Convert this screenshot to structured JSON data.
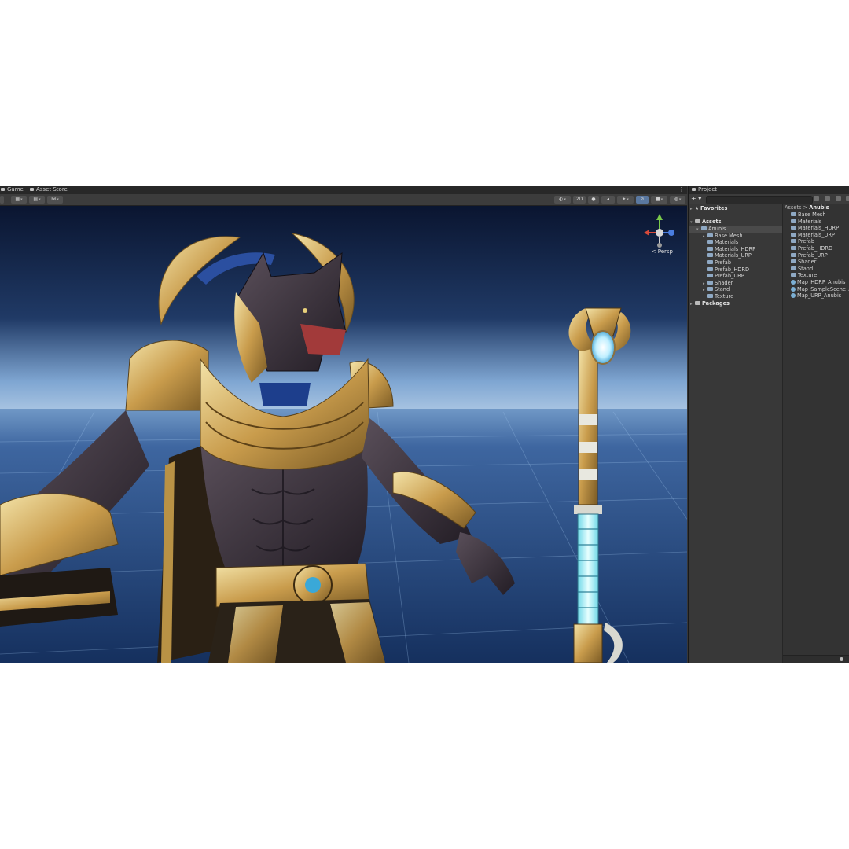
{
  "scene_tabs": [
    {
      "label": "Game"
    },
    {
      "label": "Asset Store"
    }
  ],
  "scene_toolbar": {
    "mode_2d": "2D",
    "persp_label": "< Persp",
    "more": "⋮"
  },
  "project": {
    "tab_label": "Project",
    "add_label": "+ ▾",
    "search_placeholder": "",
    "tree": {
      "favorites": "Favorites",
      "assets": "Assets",
      "anubis": "Anubis",
      "children": [
        "Base Mesh",
        "Materials",
        "Materials_HDRP",
        "Materials_URP",
        "Prefab",
        "Prefab_HDRD",
        "Prefab_URP",
        "Shader",
        "Stand",
        "Texture"
      ],
      "packages": "Packages"
    },
    "breadcrumb": {
      "root": "Assets",
      "sep": ">",
      "current": "Anubis"
    },
    "grid_items": [
      {
        "label": "Base Mesh",
        "icon": "folder-icon"
      },
      {
        "label": "Materials",
        "icon": "folder-icon"
      },
      {
        "label": "Materials_HDRP",
        "icon": "folder-icon"
      },
      {
        "label": "Materials_URP",
        "icon": "folder-icon"
      },
      {
        "label": "Prefab",
        "icon": "folder-icon"
      },
      {
        "label": "Prefab_HDRD",
        "icon": "folder-icon"
      },
      {
        "label": "Prefab_URP",
        "icon": "folder-icon"
      },
      {
        "label": "Shader",
        "icon": "folder-icon"
      },
      {
        "label": "Stand",
        "icon": "folder-icon"
      },
      {
        "label": "Texture",
        "icon": "folder-icon"
      },
      {
        "label": "Map_HDRP_Anubis",
        "icon": "scene-icon"
      },
      {
        "label": "Map_SampleScene_A",
        "icon": "scene-icon"
      },
      {
        "label": "Map_URP_Anubis",
        "icon": "scene-icon"
      }
    ]
  },
  "colors": {
    "editor_bg": "#383838",
    "active_tool": "#5a78a0",
    "sky_top": "#0b1630",
    "horizon": "#6f9acb",
    "floor": "#1d3c6e"
  }
}
